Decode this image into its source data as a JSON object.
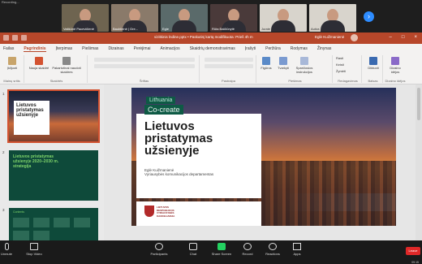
{
  "zoom": {
    "status": "Recording...",
    "participants": [
      {
        "name": "Vaitkūnė Pacevičienė"
      },
      {
        "name": "Baublienė | Gre..."
      },
      {
        "name": "Egle"
      },
      {
        "name": "Rūta Balčiūnytė"
      },
      {
        "name": "Jurate"
      },
      {
        "name": "Aušra"
      }
    ],
    "next_icon": "chevron-right-icon",
    "toolbar": [
      {
        "label": "Unmute",
        "icon": "microphone-icon"
      },
      {
        "label": "Stop Video",
        "icon": "camera-icon"
      },
      {
        "label": "Participants",
        "icon": "people-icon"
      },
      {
        "label": "Chat",
        "icon": "chat-icon"
      },
      {
        "label": "Share Screen",
        "icon": "share-screen-icon"
      },
      {
        "label": "Record",
        "icon": "record-icon"
      },
      {
        "label": "Reactions",
        "icon": "smile-icon"
      },
      {
        "label": "Apps",
        "icon": "apps-icon"
      }
    ],
    "participants_count": "6",
    "chat_count": "1",
    "leave": "Leave",
    "clock": "09:15"
  },
  "ppt": {
    "title": "vizitkinis lndine.pptx • Paskutinį kartą modifikuota: Prieš 4h m",
    "user": "Eglė Kuižmanienė",
    "tabs": [
      "Failas",
      "Pagrindinis",
      "Įterpimas",
      "Piešimas",
      "Dizainas",
      "Perėjimai",
      "Animacijos",
      "Skaidrių demonstravimas",
      "Įrašyti",
      "Peržiūra",
      "Rodymas",
      "Žinynas"
    ],
    "active_tab": "Pagrindinis",
    "ribbon_groups": [
      "Mainų sritis",
      "Skaidrės",
      "Šriftas",
      "Pastraipa",
      "Piešimas",
      "Redagavimas",
      "Balsas",
      "Dizaino idėjos"
    ],
    "ribbon_buttons": [
      "Įklijuoti",
      "Nauja skaidrė",
      "Pakartotinai naudoti skaidres",
      "Figūros",
      "Tvarkyti",
      "Sparčiosios instrukcijos",
      "Rasti",
      "Keisti",
      "Žymėti",
      "Diktuoti",
      "Dizaino idėjos"
    ]
  },
  "thumbnails": [
    {
      "num": "1",
      "title": "Lietuvos pristatymas užsienyje"
    },
    {
      "num": "2",
      "title": "Lietuvos pristatymas užsienyje 2020–2030 m. strategija"
    },
    {
      "num": "3",
      "title": "Contents"
    }
  ],
  "slide": {
    "tag1": "Lithuania",
    "tag2": "Co-create",
    "title_line1": "Lietuvos",
    "title_line2": "pristatymas",
    "title_line3": "užsienyje",
    "author": "Eglė Kuižmanienė",
    "department": "Vyriausybės komunikacijos departamentas",
    "crest_text_1": "LIETUVOS",
    "crest_text_2": "RESPUBLIKOS",
    "crest_text_3": "VYRIAUSYBĖS",
    "crest_text_4": "KANCELIARIJA"
  }
}
